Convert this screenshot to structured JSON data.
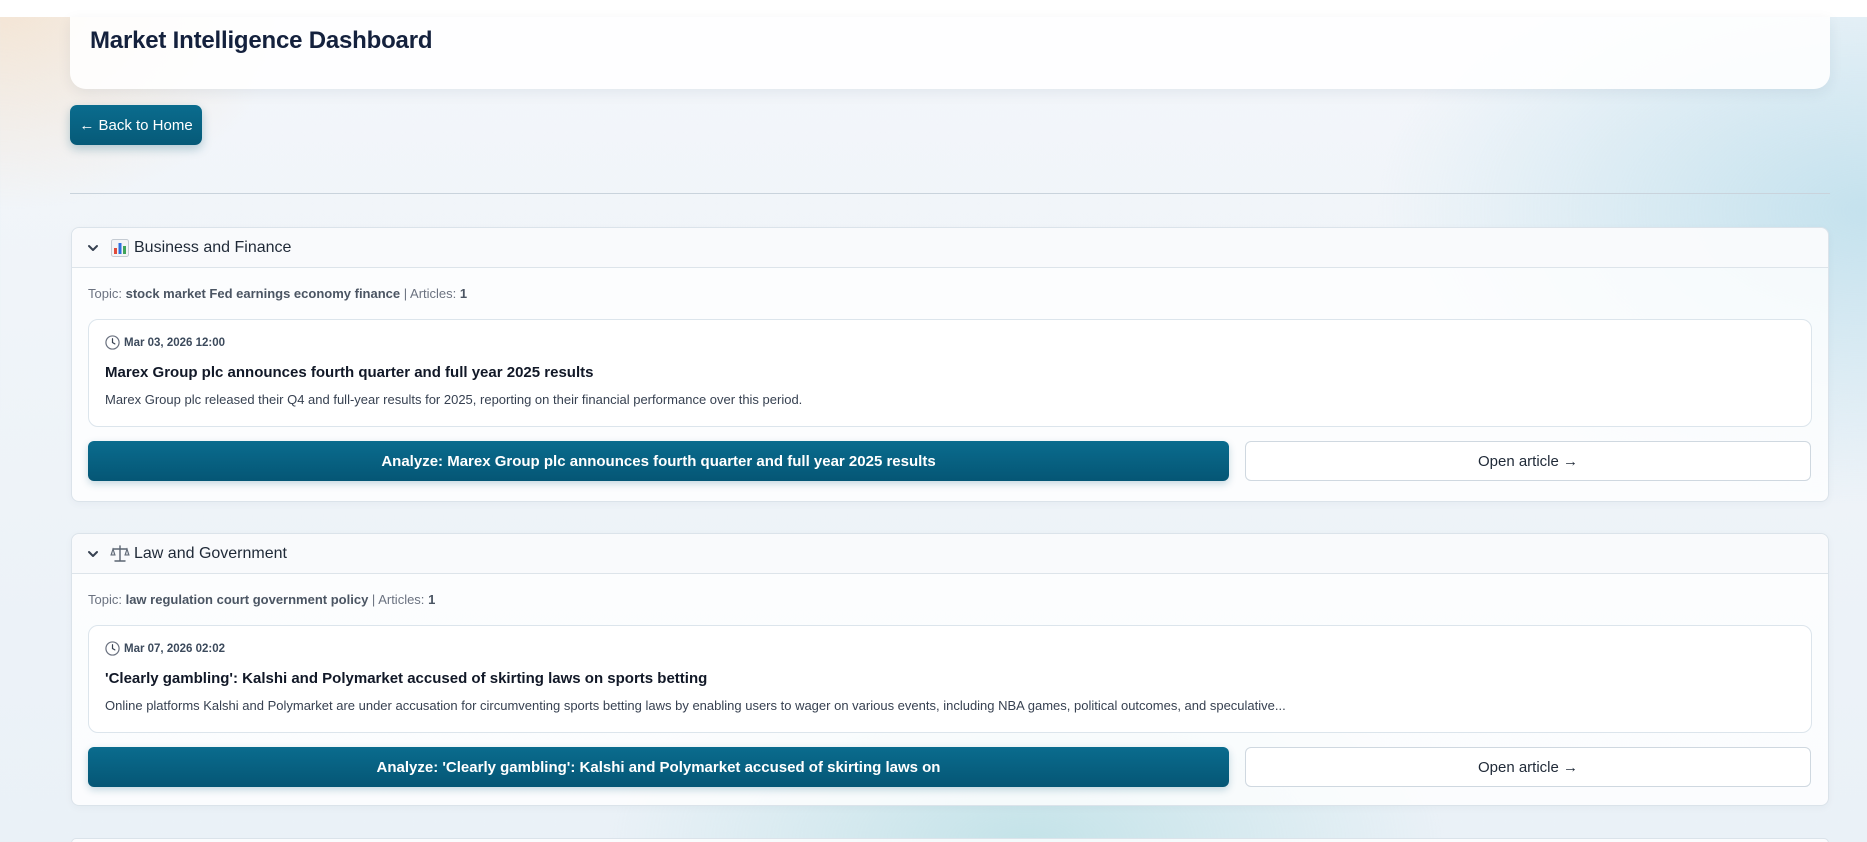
{
  "header": {
    "title": "Market Intelligence Dashboard"
  },
  "nav": {
    "back_label": "← Back to Home"
  },
  "labels": {
    "topic_prefix": "Topic:",
    "articles_prefix": "| Articles:"
  },
  "sections": [
    {
      "title": "Business and Finance",
      "icon": "bar-chart-icon",
      "topic": "stock market Fed earnings economy finance",
      "article_count": "1",
      "article": {
        "date": "Mar 03, 2026 12:00",
        "title": "Marex Group plc announces fourth quarter and full year 2025 results",
        "summary": "Marex Group plc released their Q4 and full-year results for 2025, reporting on their financial performance over this period."
      },
      "analyze_label": "Analyze: Marex Group plc announces fourth quarter and full year 2025 results",
      "open_label": "Open article →"
    },
    {
      "title": "Law and Government",
      "icon": "scales-icon",
      "topic": "law regulation court government policy",
      "article_count": "1",
      "article": {
        "date": "Mar 07, 2026 02:02",
        "title": "'Clearly gambling': Kalshi and Polymarket accused of skirting laws on sports betting",
        "summary": "Online platforms Kalshi and Polymarket are under accusation for circumventing sports betting laws by enabling users to wager on various events, including NBA games, political outcomes, and speculative..."
      },
      "analyze_label": "Analyze: 'Clearly gambling': Kalshi and Polymarket accused of skirting laws on",
      "open_label": "Open article →"
    }
  ],
  "colors": {
    "primary": "#0a6c8e",
    "primary_dark": "#055675",
    "title": "#14213d"
  }
}
